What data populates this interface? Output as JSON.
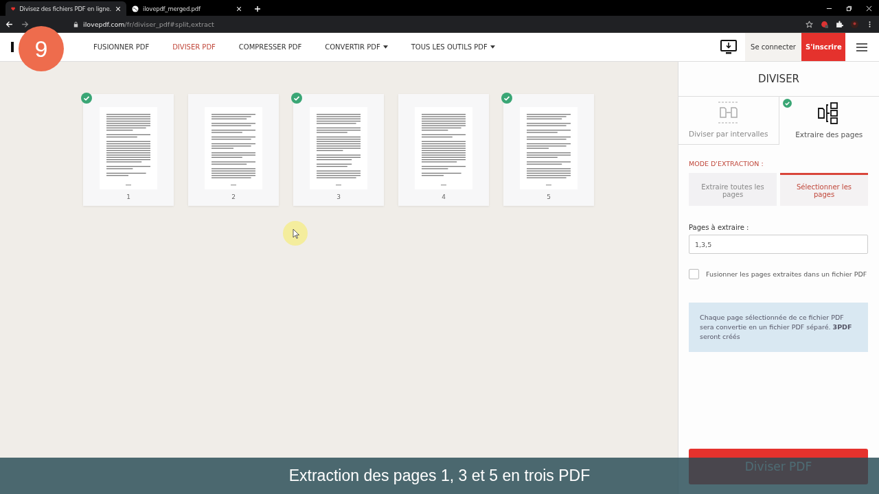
{
  "browser": {
    "tabs": [
      {
        "title": "Divisez des fichiers PDF en ligne.",
        "selected": true
      },
      {
        "title": "ilovepdf_merged.pdf",
        "selected": false
      }
    ],
    "url_host": "ilovepdf.com",
    "url_path": "/fr/diviser_pdf#split,extract"
  },
  "step_badge": "9",
  "nav": {
    "items": [
      {
        "label": "FUSIONNER PDF",
        "selected": false,
        "dropdown": false
      },
      {
        "label": "DIVISER PDF",
        "selected": true,
        "dropdown": false
      },
      {
        "label": "COMPRESSER PDF",
        "selected": false,
        "dropdown": false
      },
      {
        "label": "CONVERTIR PDF",
        "selected": false,
        "dropdown": true
      },
      {
        "label": "TOUS LES OUTILS PDF",
        "selected": false,
        "dropdown": true
      }
    ],
    "login": "Se connecter",
    "signup": "S'inscrire"
  },
  "pages": [
    {
      "number": "1",
      "checked": true
    },
    {
      "number": "2",
      "checked": false
    },
    {
      "number": "3",
      "checked": true
    },
    {
      "number": "4",
      "checked": false
    },
    {
      "number": "5",
      "checked": true
    }
  ],
  "sidebar": {
    "title": "DIVISER",
    "modes": [
      {
        "kind": "ranges",
        "label": "Diviser par intervalles",
        "selected": false
      },
      {
        "kind": "extract",
        "label": "Extraire des pages",
        "selected": true
      }
    ],
    "section_label": "MODE D'EXTRACTION :",
    "options": [
      {
        "label": "Extraire toutes les pages",
        "selected": false
      },
      {
        "label": "Sélectionner les pages",
        "selected": true
      }
    ],
    "pages_label": "Pages à extraire :",
    "pages_value": "1,3,5",
    "merge": {
      "label": "Fusionner les pages extraites dans un fichier PDF",
      "checked": false
    },
    "info": "Chaque page sélectionnée de ce fichier PDF sera convertie en un fichier PDF séparé. **3PDF** seront créés",
    "submit": "Diviser PDF"
  },
  "caption": "Extraction des pages 1, 3 et 5 en trois PDF"
}
